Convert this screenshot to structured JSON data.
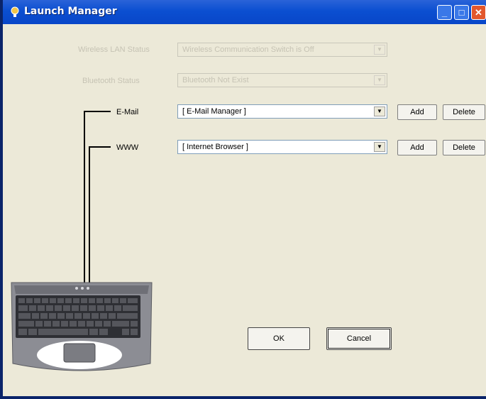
{
  "window": {
    "title": "Launch Manager",
    "controls": {
      "minimize": "_",
      "maximize": "□",
      "close": "✕"
    }
  },
  "settings": {
    "wireless": {
      "label": "Wireless LAN Status",
      "value": "Wireless Communication Switch is Off"
    },
    "bluetooth": {
      "label": "Bluetooth Status",
      "value": "Bluetooth Not Exist"
    }
  },
  "keys": {
    "email": {
      "label": "E-Mail",
      "value": "[ E-Mail Manager ]",
      "add": "Add",
      "delete": "Delete"
    },
    "www": {
      "label": "WWW",
      "value": "[ Internet Browser ]",
      "add": "Add",
      "delete": "Delete"
    }
  },
  "buttons": {
    "ok": "OK",
    "cancel": "Cancel"
  },
  "icons": {
    "app": "launch-manager-icon",
    "dropdown": "chevron-down-icon",
    "laptop": "laptop-keyboard-image"
  },
  "colors": {
    "titlebar": "#0b4fd1",
    "window": "#ece9d8",
    "close": "#e2572d"
  }
}
